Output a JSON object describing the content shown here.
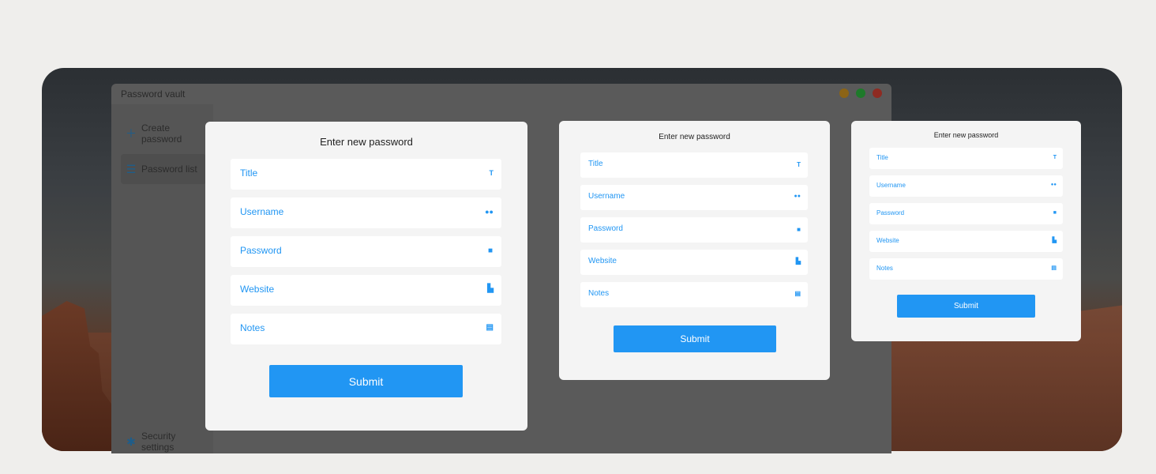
{
  "window": {
    "title": "Password vault"
  },
  "sidebar": {
    "items": [
      {
        "label": "Create password",
        "icon": "plus-icon"
      },
      {
        "label": "Password list",
        "icon": "list-icon"
      },
      {
        "label": "Security settings",
        "icon": "gear-icon"
      }
    ]
  },
  "form": {
    "title": "Enter new password",
    "fields": [
      {
        "label": "Title",
        "icon": "text-format-icon",
        "glyph": "T"
      },
      {
        "label": "Username",
        "icon": "people-icon",
        "glyph": "👥"
      },
      {
        "label": "Password",
        "icon": "lock-icon",
        "glyph": "🔒"
      },
      {
        "label": "Website",
        "icon": "domain-icon",
        "glyph": "▙"
      },
      {
        "label": "Notes",
        "icon": "note-icon",
        "glyph": "▤"
      }
    ],
    "submit_label": "Submit"
  },
  "colors": {
    "accent": "#2196f3",
    "card_bg": "#f4f4f4",
    "overlay": "#5a5a5a"
  }
}
